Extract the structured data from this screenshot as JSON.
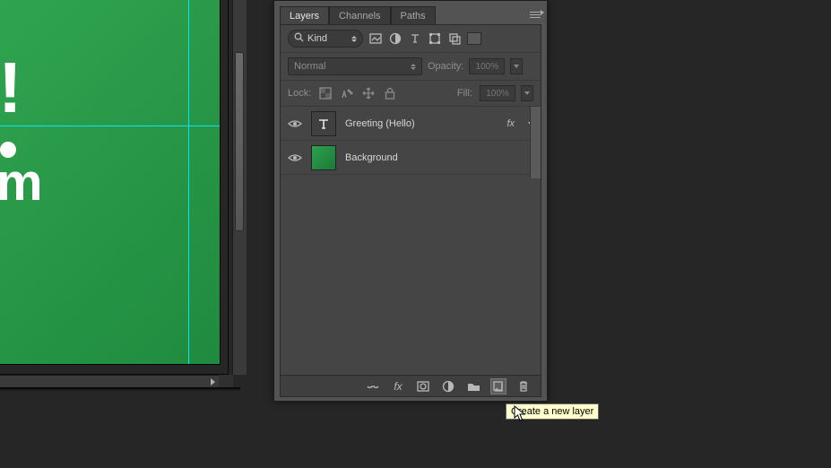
{
  "tabs": {
    "layers": "Layers",
    "channels": "Channels",
    "paths": "Paths"
  },
  "filter": {
    "kind": "Kind"
  },
  "blend": {
    "mode": "Normal",
    "opacity_label": "Opacity:",
    "opacity_value": "100%"
  },
  "lock": {
    "label": "Lock:",
    "fill_label": "Fill:",
    "fill_value": "100%"
  },
  "layers": [
    {
      "name": "Greeting (Hello)",
      "type": "text",
      "has_fx": true
    },
    {
      "name": "Background",
      "type": "image",
      "has_fx": false
    }
  ],
  "fx_label": "fx",
  "tooltip": "Create a new layer"
}
